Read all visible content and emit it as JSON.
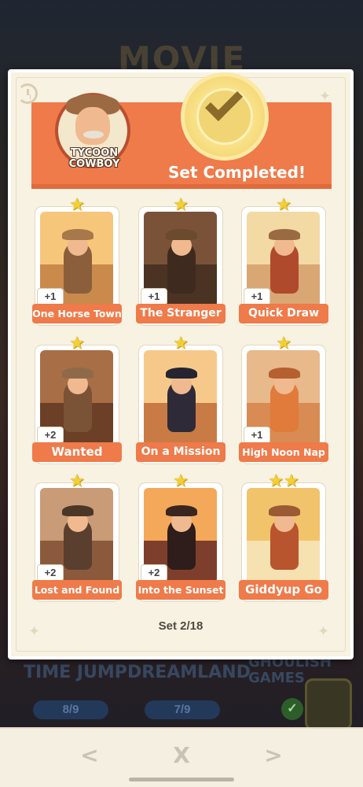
{
  "background": {
    "album_title": "MOVIE",
    "sets": [
      {
        "name": "TIME JUMP",
        "progress": "8/9"
      },
      {
        "name": "DREAMLAND",
        "progress": "7/9"
      },
      {
        "name": "GHOULISH GAMES",
        "progress": ""
      }
    ]
  },
  "set": {
    "logo_line1": "TYCOON",
    "logo_line2": "COWBOY",
    "status": "Set Completed!",
    "page_indicator": "Set 2/18"
  },
  "cards": [
    {
      "name": "One Horse Town",
      "stars": 1,
      "count": "+1"
    },
    {
      "name": "The Stranger",
      "stars": 1,
      "count": "+1"
    },
    {
      "name": "Quick Draw",
      "stars": 1,
      "count": "+1"
    },
    {
      "name": "Wanted",
      "stars": 1,
      "count": "+2"
    },
    {
      "name": "On a Mission",
      "stars": 1,
      "count": ""
    },
    {
      "name": "High Noon Nap",
      "stars": 1,
      "count": "+1"
    },
    {
      "name": "Lost and Found",
      "stars": 1,
      "count": "+2"
    },
    {
      "name": "Into the Sunset",
      "stars": 1,
      "count": "+2"
    },
    {
      "name": "Giddyup Go",
      "stars": 2,
      "count": ""
    }
  ],
  "nav": {
    "prev": "<",
    "close": "X",
    "next": ">"
  },
  "colors": {
    "accent": "#ef7a4a",
    "panel": "#f8f2e2",
    "star": "#f4cf34",
    "badge": "#f1d574"
  }
}
